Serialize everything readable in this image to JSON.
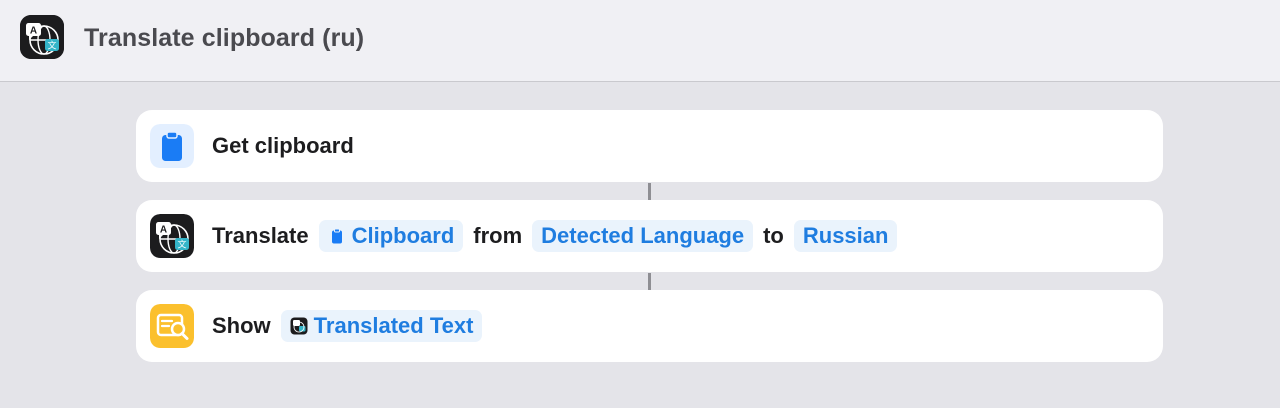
{
  "header": {
    "title": "Translate clipboard (ru)",
    "app_icon": "translate-app-icon"
  },
  "colors": {
    "background": "#e4e4e9",
    "card": "#ffffff",
    "token_bg": "#eaf3fc",
    "token_text": "#1f7de0",
    "clipboard_blue": "#1a7cf5",
    "show_yellow": "#fbc02d",
    "connector": "#8e8e93"
  },
  "actions": [
    {
      "icon": "clipboard-icon",
      "label": "Get clipboard"
    },
    {
      "icon": "translate-icon",
      "label": "Translate",
      "input_token": "Clipboard",
      "from_word": "from",
      "source_language": "Detected Language",
      "to_word": "to",
      "target_language": "Russian"
    },
    {
      "icon": "show-result-icon",
      "label": "Show",
      "output_token": "Translated Text"
    }
  ]
}
